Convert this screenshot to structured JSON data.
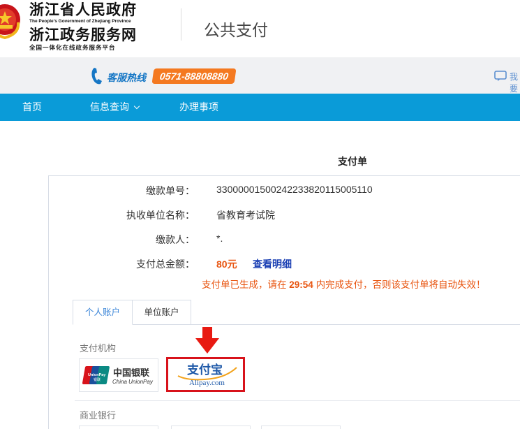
{
  "header": {
    "brand_title": "浙江省人民政府",
    "brand_english": "The People's Government of Zhejiang Province",
    "brand_subtitle": "浙江政务服务网",
    "brand_slogan": "全国一体化在线政务服务平台",
    "page_heading": "公共支付",
    "emblem_icon": "national-emblem-icon"
  },
  "hotline": {
    "label": "客服热线",
    "number": "0571-88808880",
    "chat_text": "我要",
    "phone_icon": "phone-icon",
    "chat_icon": "chat-bubble-icon"
  },
  "nav": {
    "items": [
      {
        "label": "首页"
      },
      {
        "label": "信息查询"
      },
      {
        "label": "办理事项"
      }
    ]
  },
  "form": {
    "title": "支付单",
    "rows": [
      {
        "label": "缴款单号：",
        "value": "330000015002422338201150051​10"
      },
      {
        "label": "执收单位名称：",
        "value": "省教育考试院"
      },
      {
        "label": "缴款人：",
        "value": "*."
      },
      {
        "label": "支付总金额：",
        "value": "80元"
      }
    ],
    "detail_link": "查看明细",
    "notice_prefix": "支付单已生成，请在",
    "countdown": "29:54",
    "notice_suffix": "内完成支付，否则该支付单将自动失效！"
  },
  "tabs": [
    {
      "label": "个人账户",
      "active": true
    },
    {
      "label": "单位账户",
      "active": false
    }
  ],
  "payment": {
    "institutions_label": "支付机构",
    "unionpay_zh": "中国银联",
    "unionpay_en": "China UnionPay",
    "alipay_zh": "支付宝",
    "alipay_en": "Alipay.com",
    "banks_label": "商业银行"
  },
  "colors": {
    "nav_blue": "#0a9bd8",
    "accent_orange": "#e8540f",
    "highlight_red": "#d8131b",
    "link_blue": "#1a3fb3"
  }
}
